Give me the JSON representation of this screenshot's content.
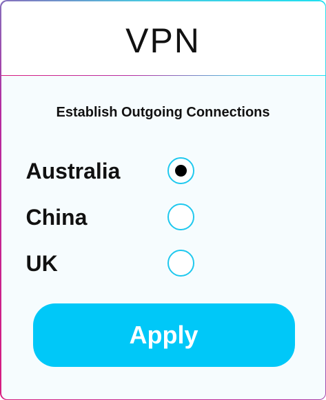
{
  "header": {
    "title": "VPN"
  },
  "section": {
    "heading": "Establish Outgoing Connections"
  },
  "options": [
    {
      "label": "Australia",
      "selected": true
    },
    {
      "label": "China",
      "selected": false
    },
    {
      "label": "UK",
      "selected": false
    }
  ],
  "actions": {
    "apply_label": "Apply"
  },
  "colors": {
    "accent": "#00c8f8",
    "radio_border": "#1ec8ee",
    "border_gradient_start": "#d81b7f",
    "border_gradient_end": "#1fe0f0"
  }
}
